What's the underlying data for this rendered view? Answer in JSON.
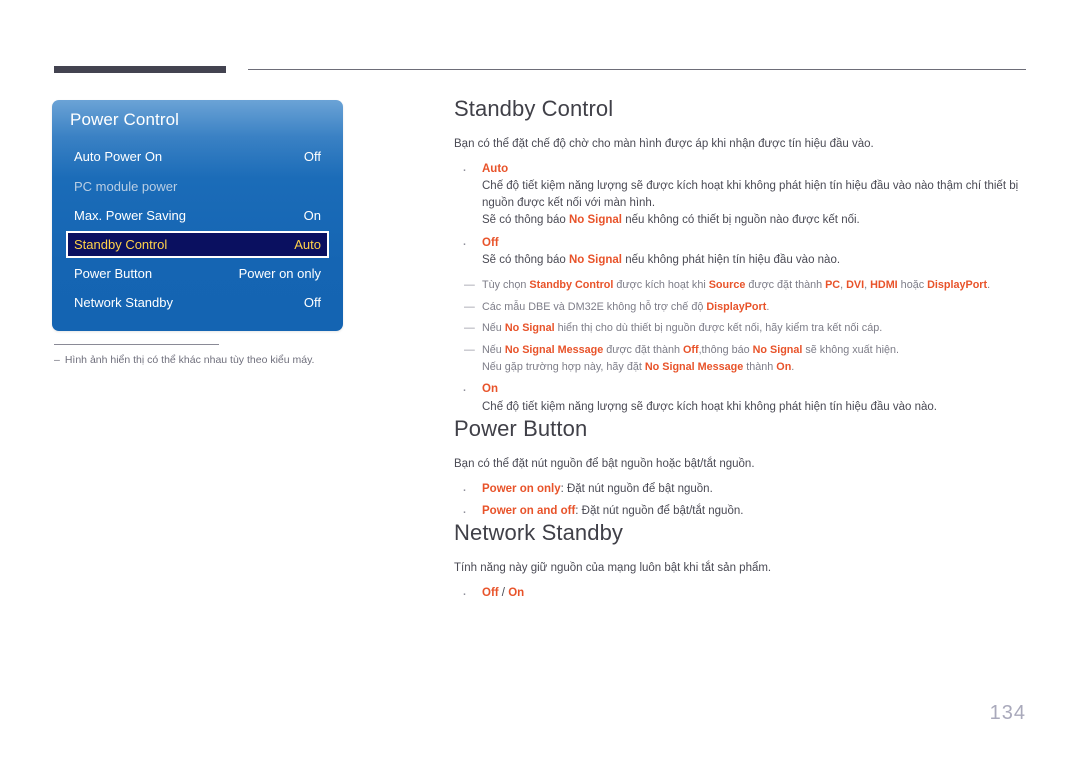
{
  "page": {
    "number": "134"
  },
  "osd": {
    "title": "Power Control",
    "rows": [
      {
        "label": "Auto Power On",
        "value": "Off",
        "selected": false,
        "dim": false
      },
      {
        "label": "PC module power",
        "value": "",
        "selected": false,
        "dim": true
      },
      {
        "label": "Max. Power Saving",
        "value": "On",
        "selected": false,
        "dim": false
      },
      {
        "label": "Standby Control",
        "value": "Auto",
        "selected": true,
        "dim": false
      },
      {
        "label": "Power Button",
        "value": "Power on only",
        "selected": false,
        "dim": false
      },
      {
        "label": "Network Standby",
        "value": "Off",
        "selected": false,
        "dim": false
      }
    ],
    "figure_note_dash": "–",
    "figure_note": "Hình ảnh hiển thị có thể khác nhau tùy theo kiểu máy."
  },
  "sections": {
    "standby_control": {
      "title": "Standby Control",
      "intro": "Bạn có thể đặt chế độ chờ cho màn hình được áp khi nhận được tín hiệu đầu vào.",
      "auto": {
        "term": "Auto",
        "desc_line1": "Chế độ tiết kiệm năng lượng sẽ được kích hoạt khi không phát hiện tín hiệu đầu vào nào thậm chí thiết bị",
        "desc_line2": "nguồn được kết nối với màn hình.",
        "desc_line3_a": "Sẽ có thông báo ",
        "desc_line3_hl": "No Signal",
        "desc_line3_b": " nếu không có thiết bị nguồn nào được kết nối."
      },
      "off": {
        "term": "Off",
        "desc_a": "Sẽ có thông báo ",
        "desc_hl": "No Signal",
        "desc_b": " nếu không phát hiện tín hiệu đầu vào nào."
      },
      "notes": [
        {
          "dash": "—",
          "parts": [
            {
              "t": "Tùy chọn ",
              "hl": false
            },
            {
              "t": "Standby Control",
              "hl": true
            },
            {
              "t": " được kích hoạt khi ",
              "hl": false
            },
            {
              "t": "Source",
              "hl": true
            },
            {
              "t": " được đặt thành ",
              "hl": false
            },
            {
              "t": "PC",
              "hl": true
            },
            {
              "t": ", ",
              "hl": false
            },
            {
              "t": "DVI",
              "hl": true
            },
            {
              "t": ", ",
              "hl": false
            },
            {
              "t": "HDMI",
              "hl": true
            },
            {
              "t": " hoặc ",
              "hl": false
            },
            {
              "t": "DisplayPort",
              "hl": true
            },
            {
              "t": ".",
              "hl": false
            }
          ]
        },
        {
          "dash": "—",
          "parts": [
            {
              "t": "Các mẫu DBE và DM32E không hỗ trợ chế độ ",
              "hl": false
            },
            {
              "t": "DisplayPort",
              "hl": true
            },
            {
              "t": ".",
              "hl": false
            }
          ]
        },
        {
          "dash": "—",
          "parts": [
            {
              "t": "Nếu ",
              "hl": false
            },
            {
              "t": "No Signal",
              "hl": true
            },
            {
              "t": " hiển thị cho dù thiết bị nguồn được kết nối, hãy kiểm tra kết nối cáp.",
              "hl": false
            }
          ]
        },
        {
          "dash": "—",
          "parts": [
            {
              "t": "Nếu ",
              "hl": false
            },
            {
              "t": "No Signal Message",
              "hl": true
            },
            {
              "t": " được đặt thành ",
              "hl": false
            },
            {
              "t": "Off",
              "hl": true
            },
            {
              "t": ",thông báo ",
              "hl": false
            },
            {
              "t": "No Signal",
              "hl": true
            },
            {
              "t": " sẽ không xuất hiện.",
              "hl": false
            }
          ],
          "cont": [
            {
              "t": "Nếu gặp trường hợp này, hãy đặt ",
              "hl": false
            },
            {
              "t": "No Signal Message",
              "hl": true
            },
            {
              "t": " thành ",
              "hl": false
            },
            {
              "t": "On",
              "hl": true
            },
            {
              "t": ".",
              "hl": false
            }
          ]
        }
      ],
      "on": {
        "term": "On",
        "desc": "Chế độ tiết kiệm năng lượng sẽ được kích hoạt khi không phát hiện tín hiệu đầu vào nào."
      }
    },
    "power_button": {
      "title": "Power Button",
      "intro": "Bạn có thể đặt nút nguồn để bật nguồn hoặc bật/tắt nguồn.",
      "items": [
        {
          "term": "Power on only",
          "desc": ": Đặt nút nguồn để bật nguồn."
        },
        {
          "term": "Power on and off",
          "desc": ": Đặt nút nguồn để bật/tắt nguồn."
        }
      ]
    },
    "network_standby": {
      "title": "Network Standby",
      "intro": "Tính năng này giữ nguồn của mạng luôn bật khi tắt sản phẩm.",
      "option_off": "Off",
      "option_sep": " / ",
      "option_on": "On"
    }
  },
  "colors": {
    "accent_orange": "#e8532a",
    "osd_blue": "#1565b3",
    "osd_highlight": "#0a1060",
    "osd_highlight_text": "#ffd24a"
  }
}
